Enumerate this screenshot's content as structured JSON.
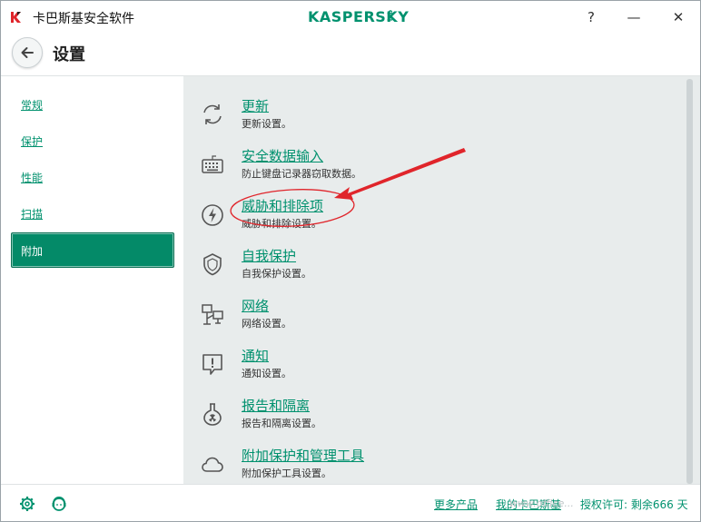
{
  "window": {
    "title": "卡巴斯基安全软件",
    "brand": "KASPERSKY",
    "brand_suffix": "lab",
    "help": "?",
    "minimize": "—",
    "close": "✕"
  },
  "header": {
    "title": "设置"
  },
  "sidebar": {
    "items": [
      {
        "label": "常规"
      },
      {
        "label": "保护"
      },
      {
        "label": "性能"
      },
      {
        "label": "扫描"
      },
      {
        "label": "附加",
        "active": true
      }
    ]
  },
  "main": {
    "rows": [
      {
        "title": "更新",
        "desc": "更新设置。",
        "icon": "refresh-icon"
      },
      {
        "title": "安全数据输入",
        "desc": "防止键盘记录器窃取数据。",
        "icon": "keyboard-icon"
      },
      {
        "title": "威胁和排除项",
        "desc": "威胁和排除设置。",
        "icon": "lightning-icon"
      },
      {
        "title": "自我保护",
        "desc": "自我保护设置。",
        "icon": "shield-icon"
      },
      {
        "title": "网络",
        "desc": "网络设置。",
        "icon": "network-icon"
      },
      {
        "title": "通知",
        "desc": "通知设置。",
        "icon": "notification-icon"
      },
      {
        "title": "报告和隔离",
        "desc": "报告和隔离设置。",
        "icon": "flask-icon"
      },
      {
        "title": "附加保护和管理工具",
        "desc": "附加保护工具设置。",
        "icon": "cloud-icon"
      }
    ]
  },
  "footer": {
    "more_products": "更多产品",
    "my_kaspersky": "我的卡巴斯基",
    "license": "授权许可: 剩余666 天",
    "watermark": "www.office..."
  },
  "colors": {
    "accent": "#00916e",
    "active_bg": "#048a68",
    "annotation": "#e0252b"
  }
}
